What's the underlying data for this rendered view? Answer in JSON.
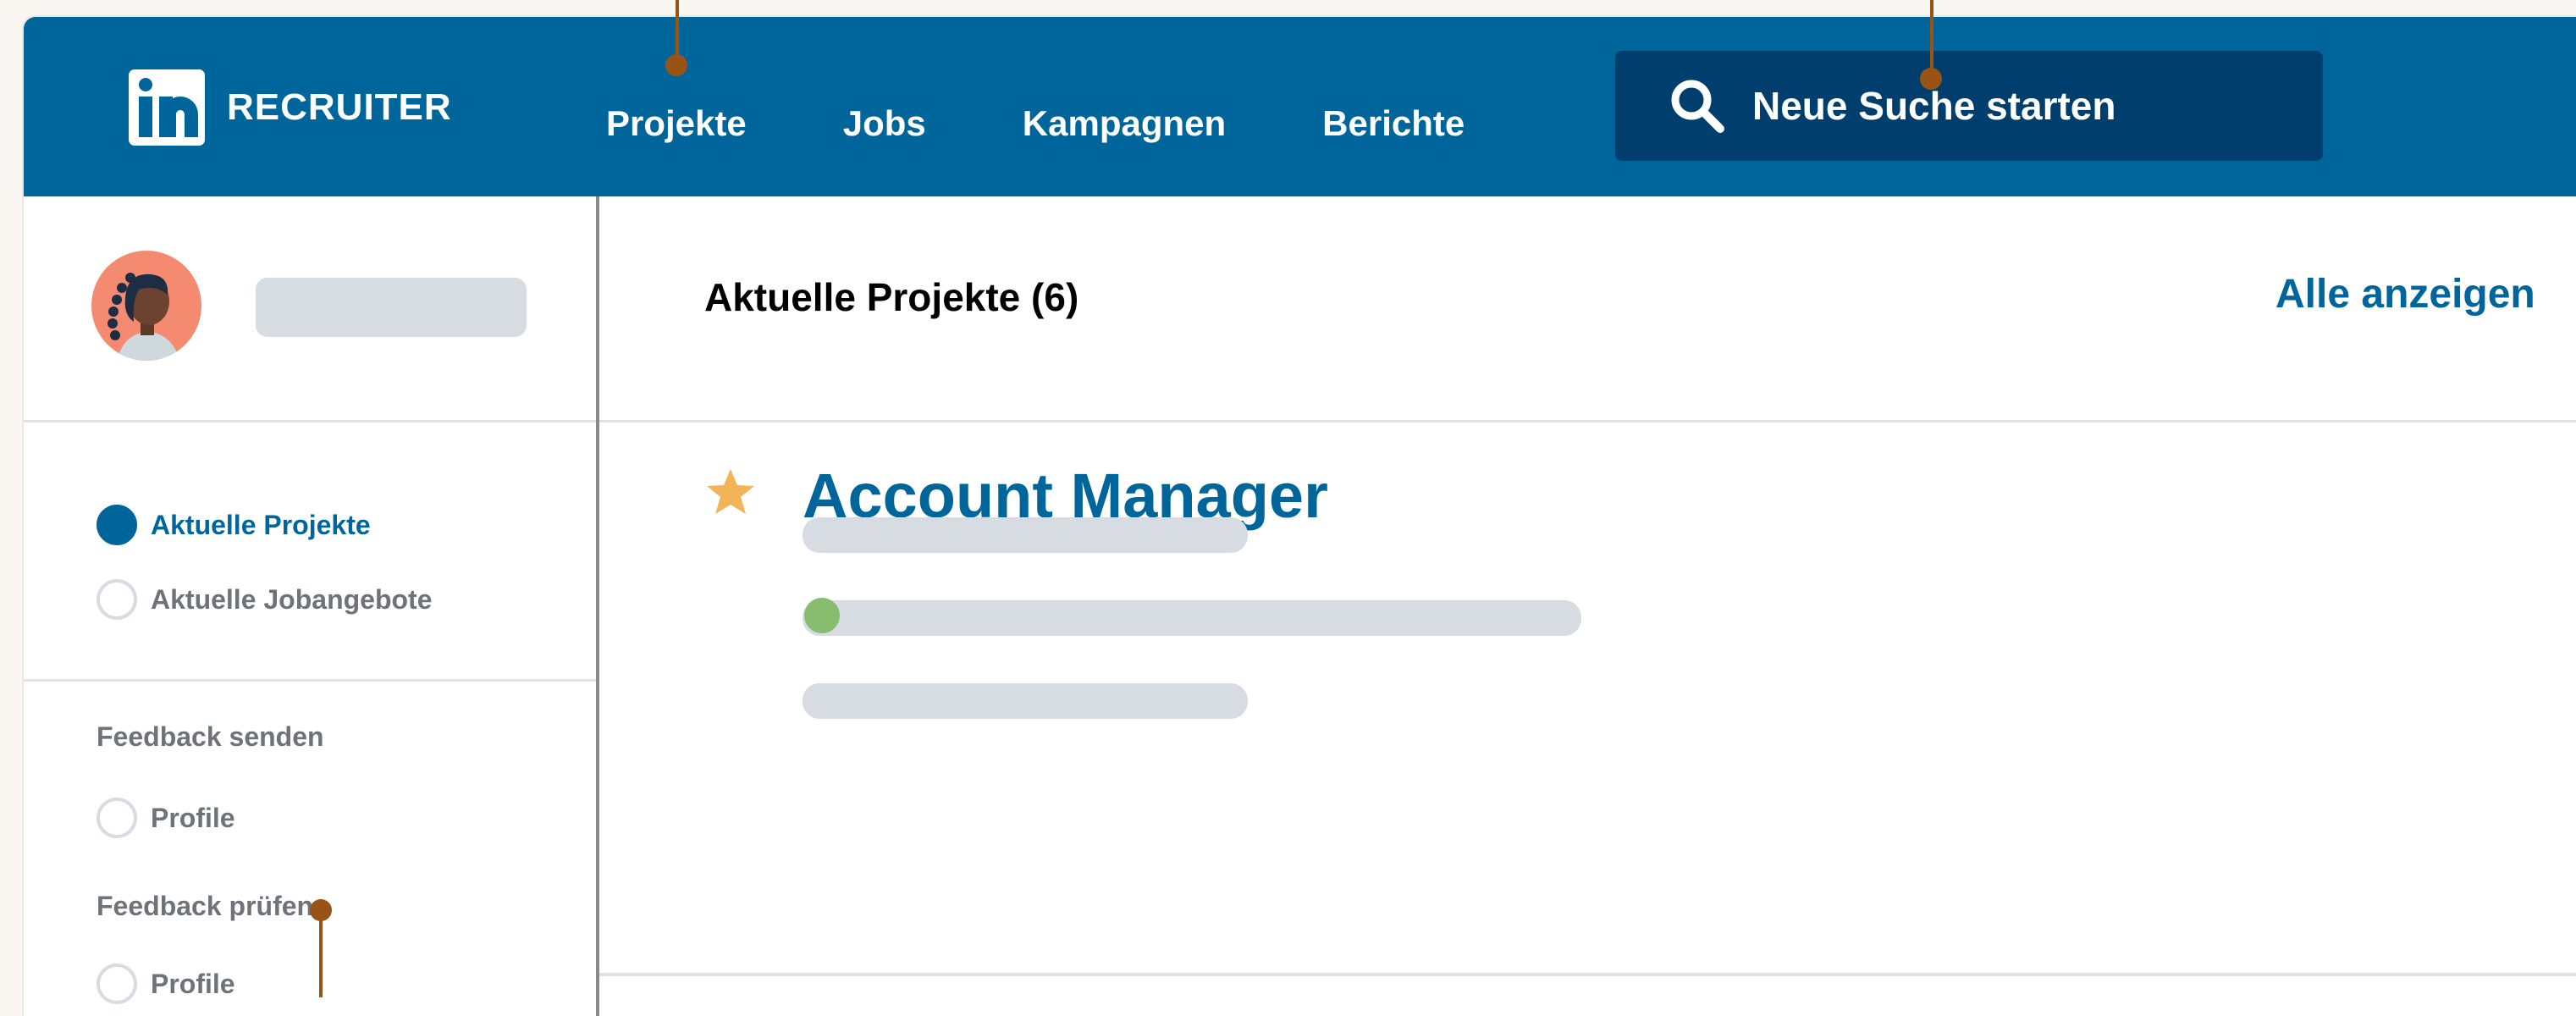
{
  "brand": {
    "name": "RECRUITER",
    "logo": "in"
  },
  "nav": {
    "items": [
      "Projekte",
      "Jobs",
      "Kampagnen",
      "Berichte"
    ]
  },
  "search": {
    "label": "Neue Suche starten",
    "icon": "search-icon"
  },
  "sidebar": {
    "filters": [
      {
        "label": "Aktuelle Projekte",
        "selected": true
      },
      {
        "label": "Aktuelle Jobangebote",
        "selected": false
      }
    ],
    "sections": [
      {
        "title": "Feedback senden",
        "option": "Profile"
      },
      {
        "title": "Feedback prüfen",
        "option": "Profile"
      }
    ]
  },
  "main": {
    "title": "Aktuelle Projekte (6)",
    "show_all": "Alle anzeigen",
    "projects": [
      {
        "title": "Account Manager",
        "starred": true,
        "status_color": "#86bc6e"
      }
    ]
  },
  "colors": {
    "brand_blue": "#00659b",
    "search_dark": "#003f6d",
    "star": "#f2b456",
    "placeholder": "#d6dce1",
    "pin": "#995314"
  }
}
